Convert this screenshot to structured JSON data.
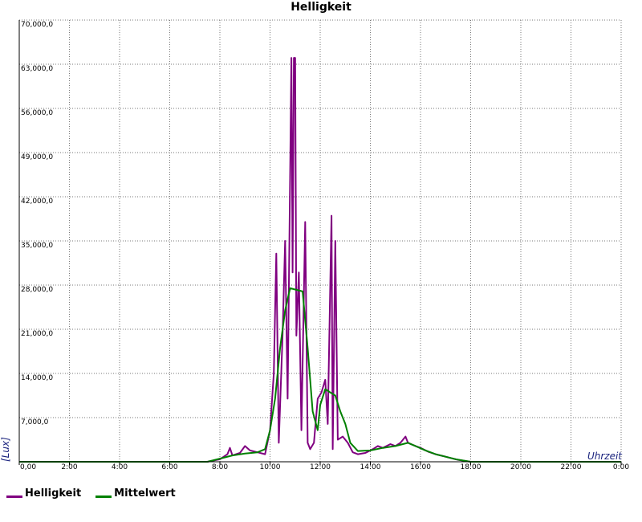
{
  "chart_data": {
    "type": "line",
    "title": "Helligkeit",
    "xlabel": "Uhrzeit",
    "ylabel": "[Lux]",
    "xlim": [
      0,
      24
    ],
    "ylim": [
      0,
      70000
    ],
    "x_tick_labels": [
      "0,00",
      "2:00",
      "4:00",
      "6:00",
      "8:00",
      "10:00",
      "12:00",
      "14:00",
      "16:00",
      "18:00",
      "20:00",
      "22:00",
      "0:00"
    ],
    "y_tick_labels": [
      "0,0",
      "7,000,0",
      "14,000,0",
      "21,000,0",
      "28,000,0",
      "35,000,0",
      "42,000,0",
      "49,000,0",
      "56,000,0",
      "63,000,0",
      "70,000,0"
    ],
    "grid": true,
    "legend_position": "bottom-left",
    "series": [
      {
        "name": "Helligkeit",
        "color": "#800080",
        "points": [
          [
            0,
            0
          ],
          [
            7.5,
            0
          ],
          [
            8,
            400
          ],
          [
            8.3,
            1200
          ],
          [
            8.4,
            2200
          ],
          [
            8.5,
            1000
          ],
          [
            8.8,
            1400
          ],
          [
            9.0,
            2500
          ],
          [
            9.2,
            1800
          ],
          [
            9.5,
            1500
          ],
          [
            9.8,
            1200
          ],
          [
            10.0,
            5000
          ],
          [
            10.15,
            14000
          ],
          [
            10.25,
            33000
          ],
          [
            10.35,
            3000
          ],
          [
            10.5,
            20000
          ],
          [
            10.6,
            35000
          ],
          [
            10.7,
            10000
          ],
          [
            10.8,
            45000
          ],
          [
            10.85,
            64000
          ],
          [
            10.9,
            30000
          ],
          [
            10.95,
            64000
          ],
          [
            11.0,
            64000
          ],
          [
            11.05,
            20000
          ],
          [
            11.15,
            30000
          ],
          [
            11.25,
            5000
          ],
          [
            11.4,
            38000
          ],
          [
            11.5,
            3000
          ],
          [
            11.6,
            2000
          ],
          [
            11.75,
            3000
          ],
          [
            11.9,
            10000
          ],
          [
            12.05,
            11000
          ],
          [
            12.2,
            13000
          ],
          [
            12.3,
            6000
          ],
          [
            12.45,
            39000
          ],
          [
            12.5,
            2000
          ],
          [
            12.6,
            35000
          ],
          [
            12.7,
            3500
          ],
          [
            12.9,
            4000
          ],
          [
            13.1,
            3000
          ],
          [
            13.3,
            1500
          ],
          [
            13.5,
            1200
          ],
          [
            13.8,
            1400
          ],
          [
            14.1,
            2000
          ],
          [
            14.3,
            2500
          ],
          [
            14.5,
            2200
          ],
          [
            14.8,
            2800
          ],
          [
            15.0,
            2500
          ],
          [
            15.2,
            3000
          ],
          [
            15.4,
            4000
          ],
          [
            15.5,
            3000
          ],
          [
            15.8,
            2500
          ],
          [
            16.0,
            2200
          ],
          [
            16.3,
            1600
          ],
          [
            16.6,
            1200
          ],
          [
            16.9,
            900
          ],
          [
            17.2,
            600
          ],
          [
            17.5,
            300
          ],
          [
            18.0,
            0
          ],
          [
            24,
            0
          ]
        ]
      },
      {
        "name": "Mittelwert",
        "color": "#008000",
        "points": [
          [
            0,
            0
          ],
          [
            7.5,
            0
          ],
          [
            8,
            500
          ],
          [
            8.5,
            1000
          ],
          [
            9.0,
            1300
          ],
          [
            9.5,
            1500
          ],
          [
            9.8,
            2000
          ],
          [
            10.0,
            5000
          ],
          [
            10.2,
            10000
          ],
          [
            10.4,
            18000
          ],
          [
            10.6,
            24000
          ],
          [
            10.8,
            27500
          ],
          [
            11.0,
            27300
          ],
          [
            11.3,
            27000
          ],
          [
            11.5,
            18000
          ],
          [
            11.7,
            8000
          ],
          [
            11.9,
            5000
          ],
          [
            12.0,
            9000
          ],
          [
            12.2,
            11500
          ],
          [
            12.4,
            11000
          ],
          [
            12.6,
            10500
          ],
          [
            12.8,
            8000
          ],
          [
            13.0,
            6000
          ],
          [
            13.2,
            3000
          ],
          [
            13.5,
            1700
          ],
          [
            14.0,
            1800
          ],
          [
            14.5,
            2200
          ],
          [
            15.0,
            2500
          ],
          [
            15.5,
            3000
          ],
          [
            15.8,
            2500
          ],
          [
            16.2,
            1800
          ],
          [
            16.6,
            1200
          ],
          [
            17.0,
            800
          ],
          [
            17.4,
            400
          ],
          [
            18.0,
            0
          ],
          [
            24,
            0
          ]
        ]
      }
    ]
  }
}
